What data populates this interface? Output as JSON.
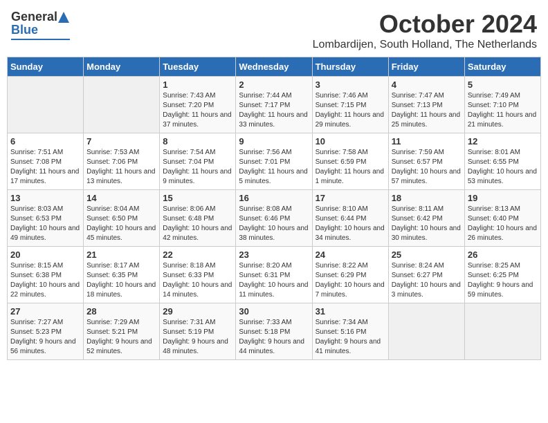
{
  "header": {
    "logo": {
      "general": "General",
      "blue": "Blue"
    },
    "title": "October 2024",
    "location": "Lombardijen, South Holland, The Netherlands"
  },
  "weekdays": [
    "Sunday",
    "Monday",
    "Tuesday",
    "Wednesday",
    "Thursday",
    "Friday",
    "Saturday"
  ],
  "weeks": [
    [
      {
        "day": "",
        "info": ""
      },
      {
        "day": "",
        "info": ""
      },
      {
        "day": "1",
        "info": "Sunrise: 7:43 AM\nSunset: 7:20 PM\nDaylight: 11 hours and 37 minutes."
      },
      {
        "day": "2",
        "info": "Sunrise: 7:44 AM\nSunset: 7:17 PM\nDaylight: 11 hours and 33 minutes."
      },
      {
        "day": "3",
        "info": "Sunrise: 7:46 AM\nSunset: 7:15 PM\nDaylight: 11 hours and 29 minutes."
      },
      {
        "day": "4",
        "info": "Sunrise: 7:47 AM\nSunset: 7:13 PM\nDaylight: 11 hours and 25 minutes."
      },
      {
        "day": "5",
        "info": "Sunrise: 7:49 AM\nSunset: 7:10 PM\nDaylight: 11 hours and 21 minutes."
      }
    ],
    [
      {
        "day": "6",
        "info": "Sunrise: 7:51 AM\nSunset: 7:08 PM\nDaylight: 11 hours and 17 minutes."
      },
      {
        "day": "7",
        "info": "Sunrise: 7:53 AM\nSunset: 7:06 PM\nDaylight: 11 hours and 13 minutes."
      },
      {
        "day": "8",
        "info": "Sunrise: 7:54 AM\nSunset: 7:04 PM\nDaylight: 11 hours and 9 minutes."
      },
      {
        "day": "9",
        "info": "Sunrise: 7:56 AM\nSunset: 7:01 PM\nDaylight: 11 hours and 5 minutes."
      },
      {
        "day": "10",
        "info": "Sunrise: 7:58 AM\nSunset: 6:59 PM\nDaylight: 11 hours and 1 minute."
      },
      {
        "day": "11",
        "info": "Sunrise: 7:59 AM\nSunset: 6:57 PM\nDaylight: 10 hours and 57 minutes."
      },
      {
        "day": "12",
        "info": "Sunrise: 8:01 AM\nSunset: 6:55 PM\nDaylight: 10 hours and 53 minutes."
      }
    ],
    [
      {
        "day": "13",
        "info": "Sunrise: 8:03 AM\nSunset: 6:53 PM\nDaylight: 10 hours and 49 minutes."
      },
      {
        "day": "14",
        "info": "Sunrise: 8:04 AM\nSunset: 6:50 PM\nDaylight: 10 hours and 45 minutes."
      },
      {
        "day": "15",
        "info": "Sunrise: 8:06 AM\nSunset: 6:48 PM\nDaylight: 10 hours and 42 minutes."
      },
      {
        "day": "16",
        "info": "Sunrise: 8:08 AM\nSunset: 6:46 PM\nDaylight: 10 hours and 38 minutes."
      },
      {
        "day": "17",
        "info": "Sunrise: 8:10 AM\nSunset: 6:44 PM\nDaylight: 10 hours and 34 minutes."
      },
      {
        "day": "18",
        "info": "Sunrise: 8:11 AM\nSunset: 6:42 PM\nDaylight: 10 hours and 30 minutes."
      },
      {
        "day": "19",
        "info": "Sunrise: 8:13 AM\nSunset: 6:40 PM\nDaylight: 10 hours and 26 minutes."
      }
    ],
    [
      {
        "day": "20",
        "info": "Sunrise: 8:15 AM\nSunset: 6:38 PM\nDaylight: 10 hours and 22 minutes."
      },
      {
        "day": "21",
        "info": "Sunrise: 8:17 AM\nSunset: 6:35 PM\nDaylight: 10 hours and 18 minutes."
      },
      {
        "day": "22",
        "info": "Sunrise: 8:18 AM\nSunset: 6:33 PM\nDaylight: 10 hours and 14 minutes."
      },
      {
        "day": "23",
        "info": "Sunrise: 8:20 AM\nSunset: 6:31 PM\nDaylight: 10 hours and 11 minutes."
      },
      {
        "day": "24",
        "info": "Sunrise: 8:22 AM\nSunset: 6:29 PM\nDaylight: 10 hours and 7 minutes."
      },
      {
        "day": "25",
        "info": "Sunrise: 8:24 AM\nSunset: 6:27 PM\nDaylight: 10 hours and 3 minutes."
      },
      {
        "day": "26",
        "info": "Sunrise: 8:25 AM\nSunset: 6:25 PM\nDaylight: 9 hours and 59 minutes."
      }
    ],
    [
      {
        "day": "27",
        "info": "Sunrise: 7:27 AM\nSunset: 5:23 PM\nDaylight: 9 hours and 56 minutes."
      },
      {
        "day": "28",
        "info": "Sunrise: 7:29 AM\nSunset: 5:21 PM\nDaylight: 9 hours and 52 minutes."
      },
      {
        "day": "29",
        "info": "Sunrise: 7:31 AM\nSunset: 5:19 PM\nDaylight: 9 hours and 48 minutes."
      },
      {
        "day": "30",
        "info": "Sunrise: 7:33 AM\nSunset: 5:18 PM\nDaylight: 9 hours and 44 minutes."
      },
      {
        "day": "31",
        "info": "Sunrise: 7:34 AM\nSunset: 5:16 PM\nDaylight: 9 hours and 41 minutes."
      },
      {
        "day": "",
        "info": ""
      },
      {
        "day": "",
        "info": ""
      }
    ]
  ]
}
